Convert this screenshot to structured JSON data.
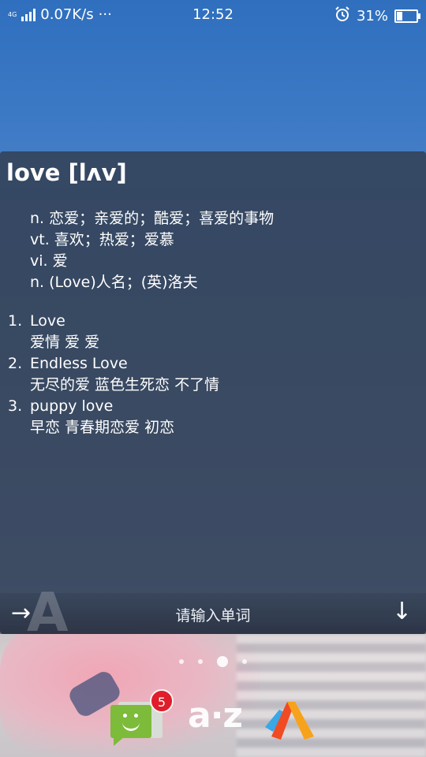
{
  "status_bar": {
    "network_type": "4G",
    "speed": "0.07K/s",
    "more": "···",
    "time": "12:52",
    "battery_percent": "31%",
    "battery_level": 0.31
  },
  "dictionary": {
    "word": "love [lʌv]",
    "definitions": [
      "n. 恋爱；亲爱的；酷爱；喜爱的事物",
      "vt. 喜欢；热爱；爱慕",
      "vi. 爱",
      "n. (Love)人名；(英)洛夫"
    ],
    "examples": [
      {
        "num": "1.",
        "phrase": "Love",
        "translation": "爱情 爱 爱"
      },
      {
        "num": "2.",
        "phrase": "Endless Love",
        "translation": "无尽的爱 蓝色生死恋 不了情"
      },
      {
        "num": "3.",
        "phrase": "puppy love",
        "translation": "早恋 青春期恋爱 初恋"
      }
    ],
    "input_placeholder": "请输入单词",
    "letter_watermark": "A"
  },
  "home": {
    "page_count": 4,
    "active_page": 3,
    "messages_badge": "5",
    "az_label": "a·z"
  },
  "colors": {
    "card_background": "#34445c",
    "messages_green": "#7dbb3a",
    "badge_red": "#e01d2a"
  }
}
